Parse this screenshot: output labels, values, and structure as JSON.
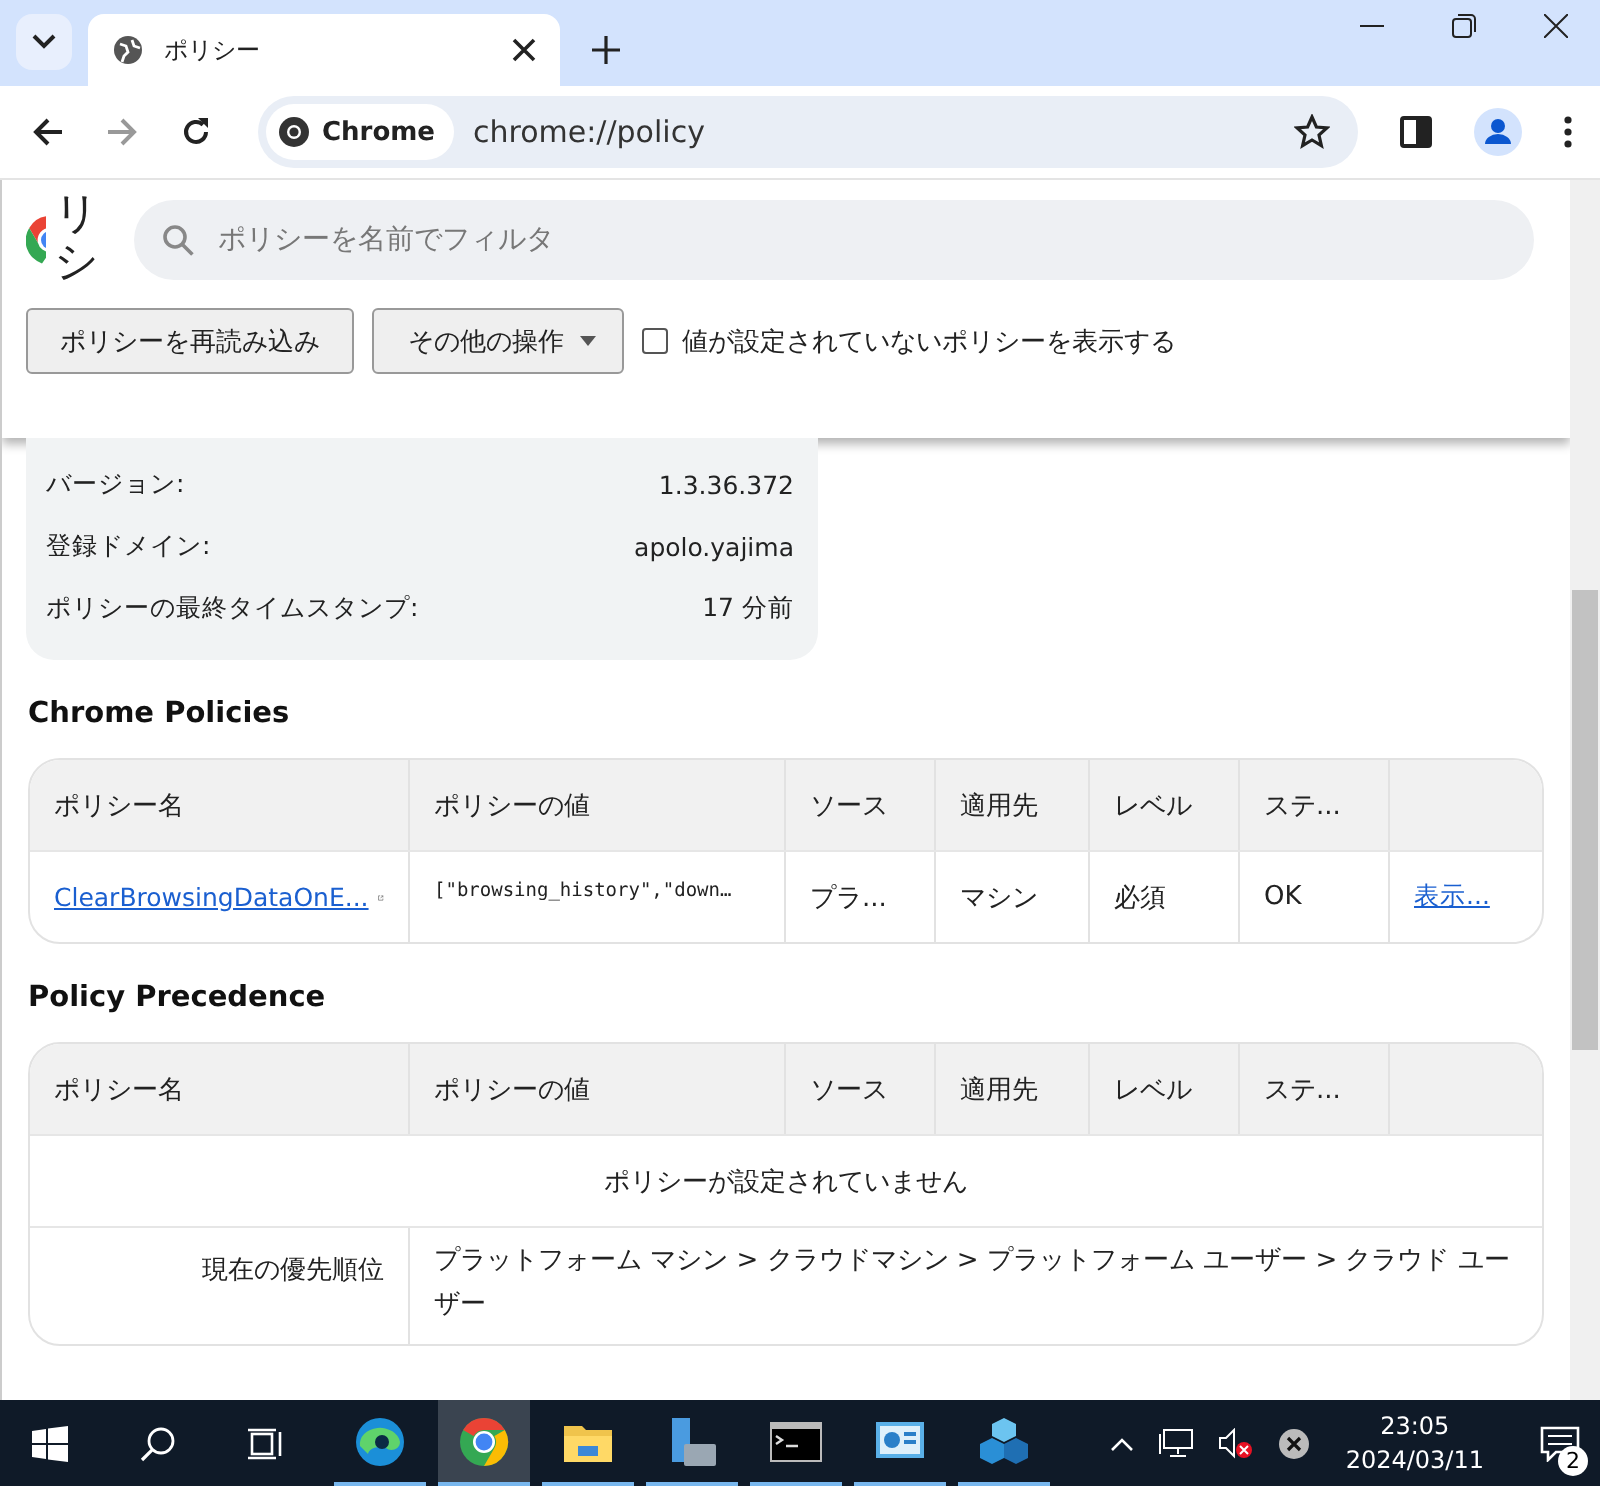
{
  "window": {
    "tabs": [
      {
        "title": "ポリシー",
        "selected": true
      }
    ],
    "address_chip": "Chrome",
    "url": "chrome://policy"
  },
  "page": {
    "title": "リシ",
    "filter_placeholder": "ポリシーを名前でフィルタ",
    "reload_button": "ポリシーを再読み込み",
    "more_button": "その他の操作",
    "show_unset": {
      "label": "値が設定されていないポリシーを表示する",
      "checked": false
    }
  },
  "info": [
    {
      "label": "バージョン:",
      "value": "1.3.36.372"
    },
    {
      "label": "登録ドメイン:",
      "value": "apolo.yajima"
    },
    {
      "label": "ポリシーの最終タイムスタンプ:",
      "value": "17 分前"
    }
  ],
  "chrome_policies": {
    "heading": "Chrome Policies",
    "columns": [
      "ポリシー名",
      "ポリシーの値",
      "ソース",
      "適用先",
      "レベル",
      "ステ..."
    ],
    "rows": [
      {
        "name": "ClearBrowsingDataOnE...",
        "value": "[\"browsing_history\",\"down…",
        "source": "プラ...",
        "scope": "マシン",
        "level": "必須",
        "status": "OK",
        "link": "表示..."
      }
    ]
  },
  "precedence": {
    "heading": "Policy Precedence",
    "columns": [
      "ポリシー名",
      "ポリシーの値",
      "ソース",
      "適用先",
      "レベル",
      "ステ..."
    ],
    "empty": "ポリシーが設定されていません",
    "order_label": "現在の優先順位",
    "order": "プラットフォーム マシン > クラウドマシン > プラットフォーム ユーザー > クラウド ユーザー"
  },
  "taskbar": {
    "apps": [
      {
        "kind": "edge",
        "selected": false
      },
      {
        "kind": "chrome",
        "selected": true
      },
      {
        "kind": "folder",
        "selected": false
      },
      {
        "kind": "server",
        "selected": false
      },
      {
        "kind": "terminal",
        "selected": false
      },
      {
        "kind": "panel",
        "selected": false
      },
      {
        "kind": "cubes",
        "selected": false
      }
    ],
    "time": "23:05",
    "date": "2024/03/11",
    "notifications": "2"
  }
}
